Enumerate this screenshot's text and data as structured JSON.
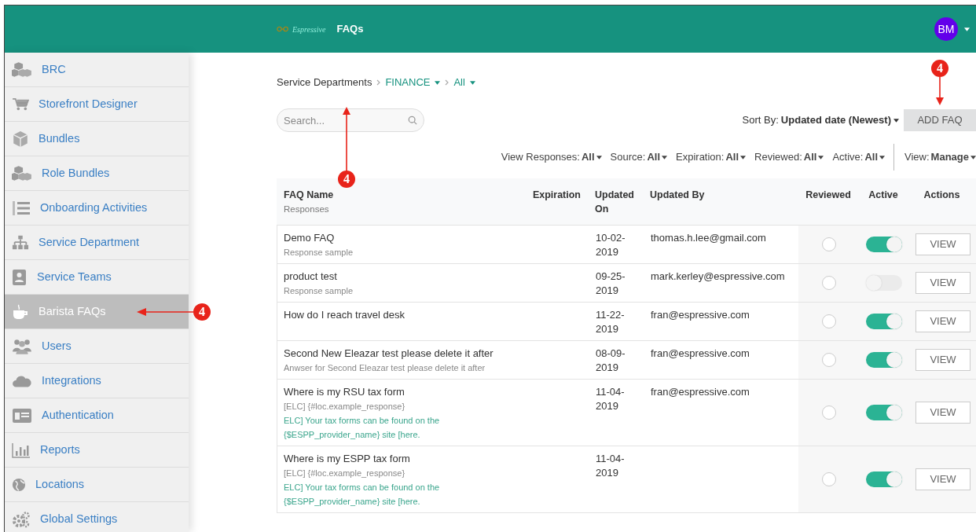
{
  "header": {
    "logo_text": "Espressive",
    "title": "FAQs",
    "avatar": "BM"
  },
  "sidebar": {
    "items": [
      {
        "label": "BRC",
        "selected": false
      },
      {
        "label": "Storefront Designer",
        "selected": false
      },
      {
        "label": "Bundles",
        "selected": false
      },
      {
        "label": "Role Bundles",
        "selected": false
      },
      {
        "label": "Onboarding Activities",
        "selected": false
      },
      {
        "label": "Service Department",
        "selected": false
      },
      {
        "label": "Service Teams",
        "selected": false
      },
      {
        "label": "Barista FAQs",
        "selected": true
      },
      {
        "label": "Users",
        "selected": false
      },
      {
        "label": "Integrations",
        "selected": false
      },
      {
        "label": "Authentication",
        "selected": false
      },
      {
        "label": "Reports",
        "selected": false
      },
      {
        "label": "Locations",
        "selected": false
      },
      {
        "label": "Global Settings",
        "selected": false
      }
    ]
  },
  "breadcrumb": [
    {
      "label": "Service Departments",
      "dropdown": false
    },
    {
      "label": "FINANCE",
      "dropdown": true
    },
    {
      "label": "All",
      "dropdown": true
    }
  ],
  "search": {
    "placeholder": "Search..."
  },
  "sort": {
    "label": "Sort By:",
    "value": "Updated date (Newest)"
  },
  "add_button": "ADD FAQ",
  "filters": [
    {
      "label": "View Responses:",
      "value": "All"
    },
    {
      "label": "Source:",
      "value": "All"
    },
    {
      "label": "Expiration:",
      "value": "All"
    },
    {
      "label": "Reviewed:",
      "value": "All"
    },
    {
      "label": "Active:",
      "value": "All"
    }
  ],
  "view_filter": {
    "label": "View:",
    "value": "Manage"
  },
  "table": {
    "columns": [
      {
        "title": "FAQ Name",
        "subtitle": "Responses"
      },
      {
        "title": "Expiration"
      },
      {
        "title": "Updated On"
      },
      {
        "title": "Updated By"
      },
      {
        "title": "Reviewed"
      },
      {
        "title": "Active"
      },
      {
        "title": "Actions"
      }
    ],
    "rows": [
      {
        "name": "Demo FAQ",
        "responses": [
          {
            "text": "Response sample",
            "kind": "plain"
          }
        ],
        "updated_on": "10-02-\n2019",
        "updated_by": "thomas.h.lee@gmail.com",
        "reviewed": false,
        "active": true,
        "action": "VIEW"
      },
      {
        "name": "product test",
        "responses": [
          {
            "text": "Response sample",
            "kind": "plain"
          }
        ],
        "updated_on": "09-25-\n2019",
        "updated_by": "mark.kerley@espressive.com",
        "reviewed": false,
        "active": false,
        "action": "VIEW"
      },
      {
        "name": "How do I reach travel desk",
        "responses": [],
        "updated_on": "11-22-\n2019",
        "updated_by": "fran@espressive.com",
        "reviewed": false,
        "active": true,
        "action": "VIEW"
      },
      {
        "name": "Second New Eleazar test please delete it after",
        "responses": [
          {
            "text": "Anwser for Second Eleazar test please delete it after",
            "kind": "plain"
          }
        ],
        "updated_on": "08-09-\n2019",
        "updated_by": "fran@espressive.com",
        "reviewed": false,
        "active": true,
        "action": "VIEW"
      },
      {
        "name": "Where is my RSU tax form",
        "responses": [
          {
            "text": "[ELC] {#loc.example_response}",
            "kind": "plain"
          },
          {
            "text": "ELC] Your tax forms can be found on the {$ESPP_provider_name} site [here.",
            "kind": "localized"
          }
        ],
        "updated_on": "11-04-\n2019",
        "updated_by": "fran@espressive.com",
        "reviewed": false,
        "active": true,
        "action": "VIEW"
      },
      {
        "name": "Where is my ESPP tax form",
        "responses": [
          {
            "text": "[ELC] {#loc.example_response}",
            "kind": "plain"
          },
          {
            "text": "ELC] Your tax forms can be found on the {$ESPP_provider_name} site [here.",
            "kind": "localized"
          }
        ],
        "updated_on": "11-04-\n2019",
        "reviewed": false,
        "active": true,
        "action": "VIEW"
      }
    ]
  },
  "callouts": [
    {
      "label": "4"
    },
    {
      "label": "4"
    },
    {
      "label": "4"
    }
  ]
}
